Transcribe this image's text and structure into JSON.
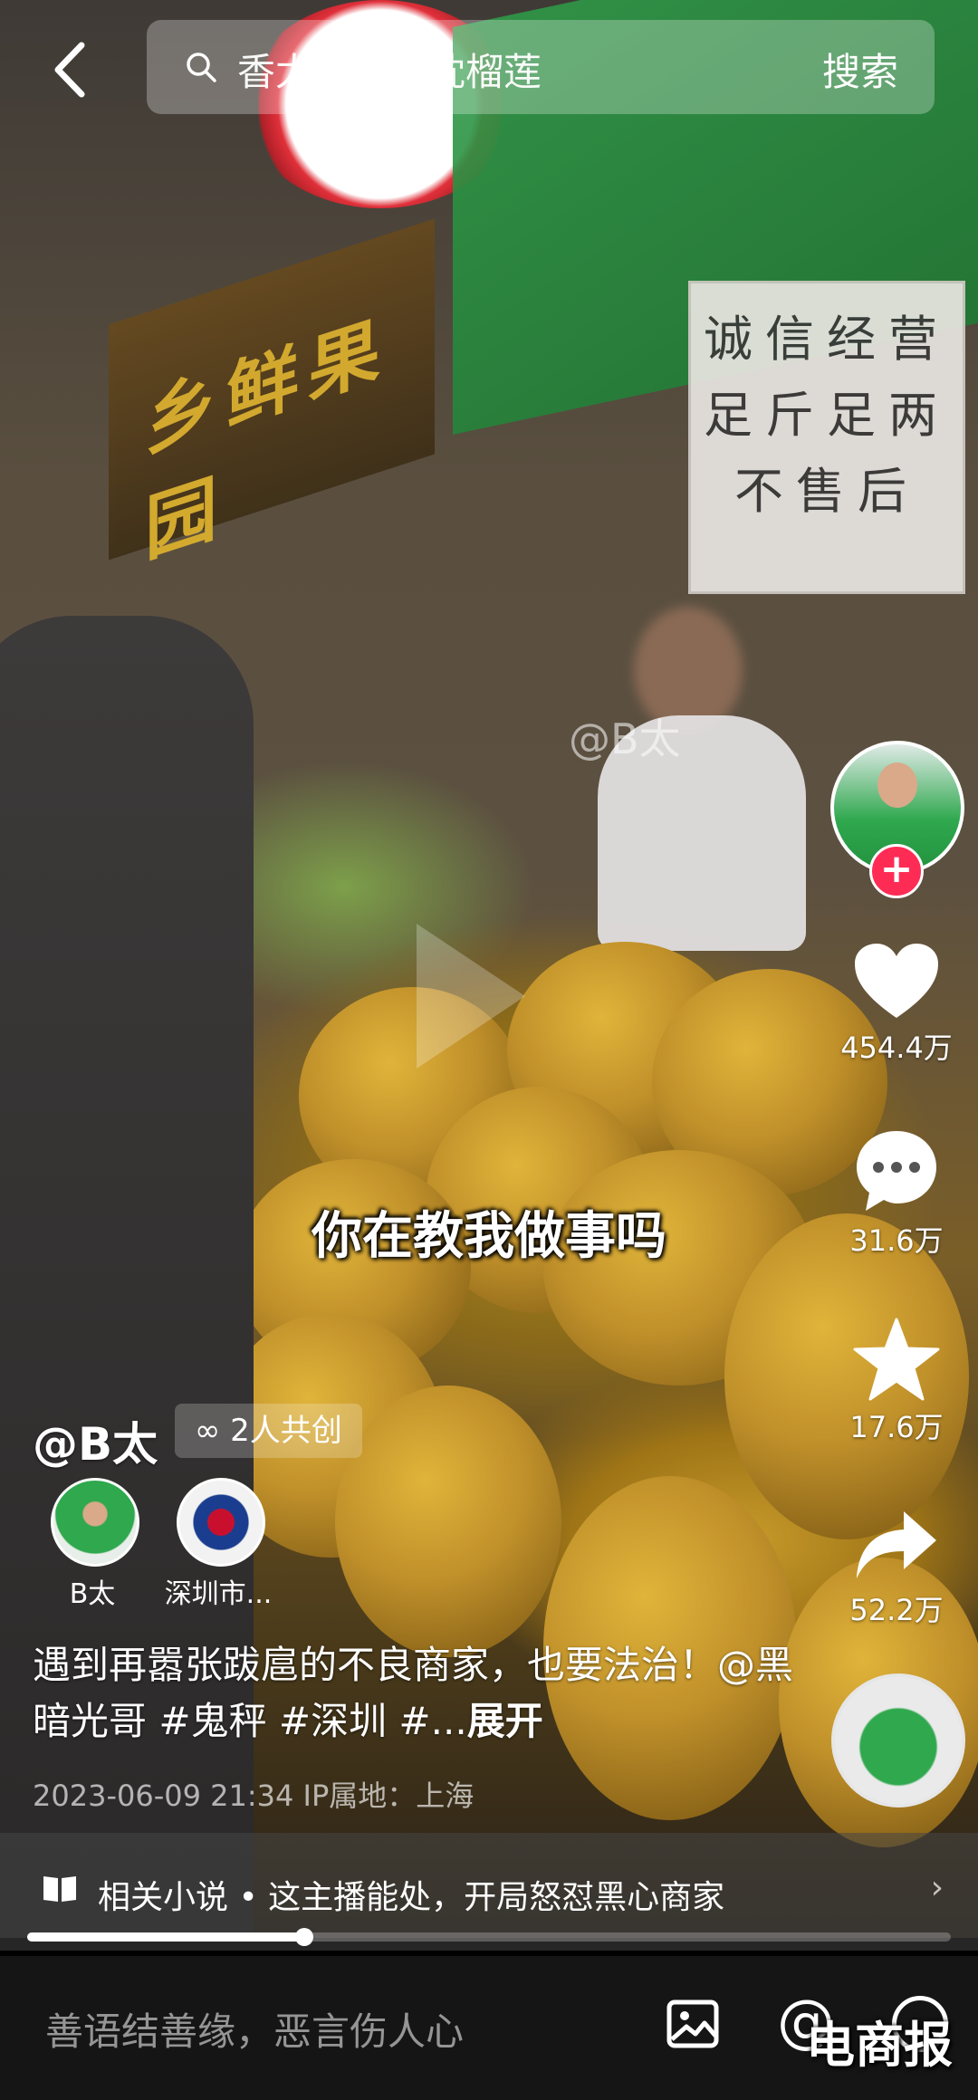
{
  "search": {
    "query": "香太泰国金枕榴莲",
    "button": "搜索"
  },
  "video": {
    "subtitle": "你在教我做事吗",
    "watermark": "@B太",
    "shop_sign": "乡鲜果园",
    "notice_lines": [
      "诚信经营",
      "足斤足两",
      "不售后"
    ]
  },
  "rail": {
    "likes": "454.4万",
    "comments": "31.6万",
    "favorites": "17.6万",
    "shares": "52.2万"
  },
  "author": {
    "name": "@B太",
    "co_create": "2人共创",
    "co_creators": [
      {
        "name": "B太"
      },
      {
        "name": "深圳市..."
      }
    ]
  },
  "caption": {
    "text": "遇到再嚣张跋扈的不良商家，也要法治！@黑暗光哥 #鬼秤 #深圳 #...",
    "more": "展开",
    "meta": "2023-06-09 21:34  IP属地：上海"
  },
  "related": {
    "text": "相关小说 • 这主播能处，开局怒怼黑心商家"
  },
  "progress": {
    "fraction": 0.3
  },
  "bottom": {
    "placeholder": "善语结善缘，恶言伤人心",
    "brand": "电商报"
  },
  "icons": [
    "back-icon",
    "search-icon",
    "heart-icon",
    "comment-icon",
    "star-icon",
    "share-icon",
    "book-icon",
    "chevron-right-icon",
    "image-icon",
    "at-icon",
    "emoji-icon"
  ],
  "colors": {
    "accent": "#fe2c55",
    "bar": "#151515"
  }
}
